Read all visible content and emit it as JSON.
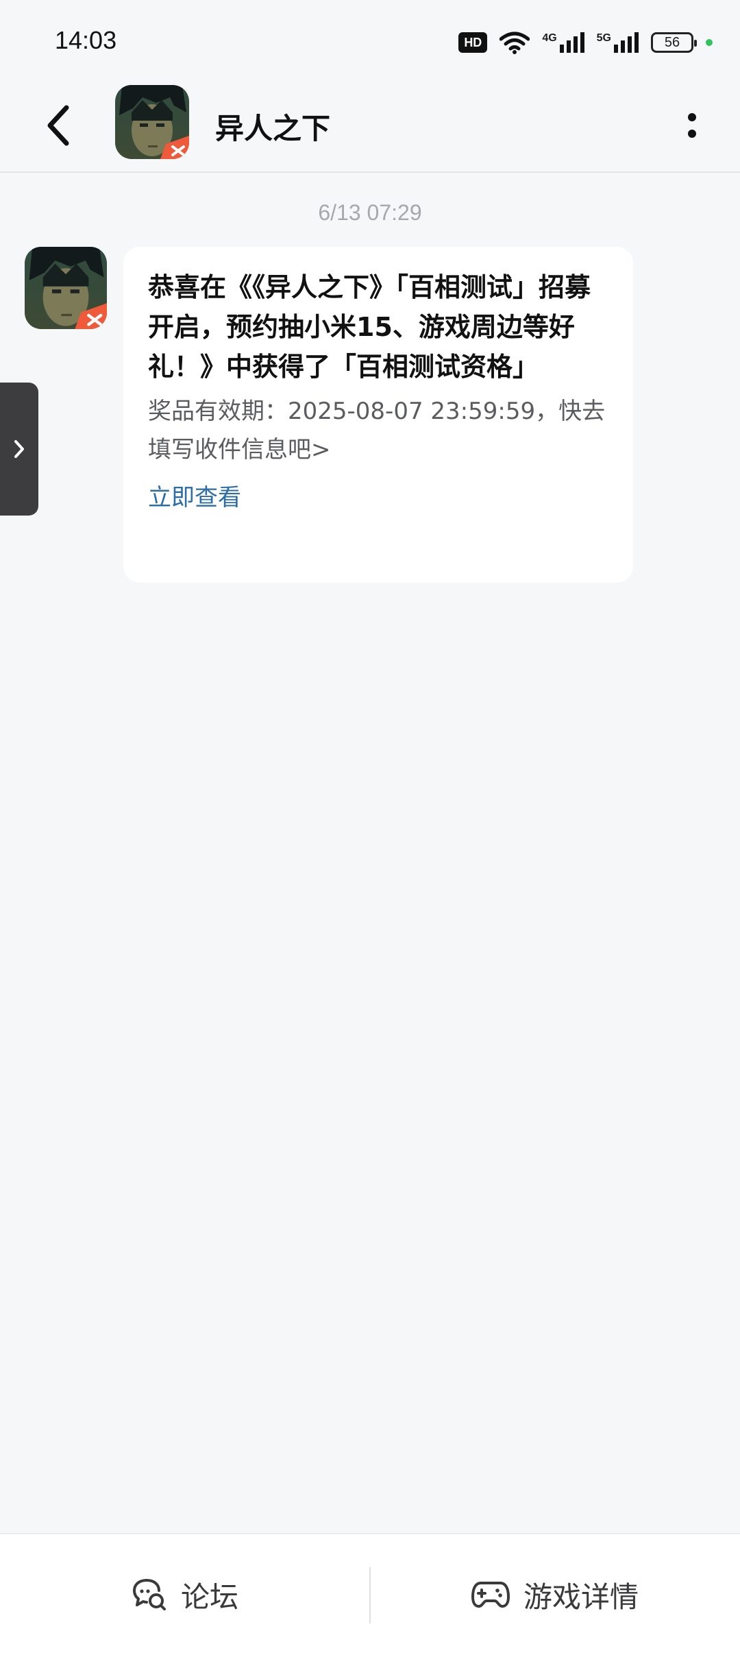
{
  "status_bar": {
    "time": "14:03",
    "hd_label": "HD",
    "network_1": "4G",
    "network_2": "5G",
    "battery": "56",
    "icons": [
      "hd-voice-icon",
      "wifi-icon",
      "signal-4g-icon",
      "signal-5g-icon",
      "battery-icon"
    ]
  },
  "header": {
    "title": "异人之下",
    "back_icon": "chevron-left-icon",
    "more_icon": "more-vertical-icon"
  },
  "message": {
    "timestamp": "6/13  07:29",
    "title": "恭喜在《《异人之下》「百相测试」招募开启，预约抽小米15、游戏周边等好礼！》中获得了「百相测试资格」",
    "body": "奖品有效期：2025-08-07 23:59:59，快去填写收件信息吧>",
    "link": "立即查看"
  },
  "side_tab": {
    "icon": "chevron-right-icon"
  },
  "bottom_bar": {
    "forum_label": "论坛",
    "forum_icon": "forum-chat-icon",
    "details_label": "游戏详情",
    "details_icon": "gamepad-icon"
  },
  "colors": {
    "background": "#f6f7f9",
    "card": "#ffffff",
    "link": "#2c6da6",
    "timestamp": "#a6a8ad",
    "side_tab": "#3d3d3f"
  }
}
